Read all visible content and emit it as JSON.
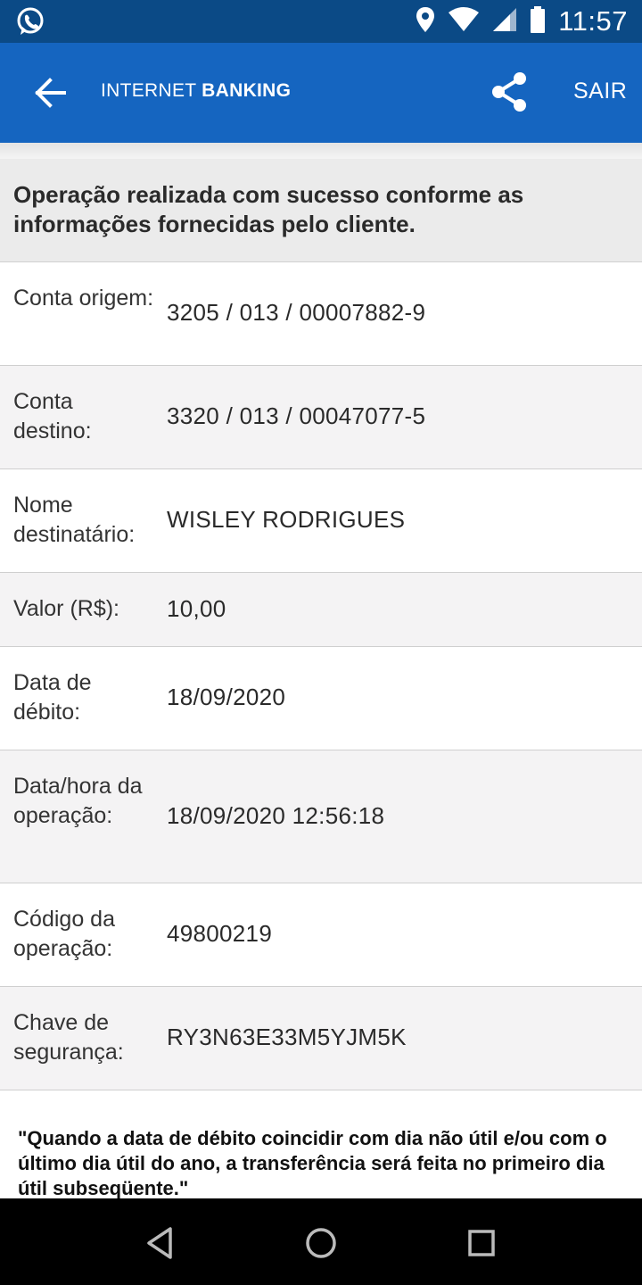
{
  "status_bar": {
    "time": "11:57",
    "icons": [
      "whatsapp-icon",
      "location-icon",
      "wifi-icon",
      "signal-icon",
      "battery-icon"
    ]
  },
  "app_bar": {
    "title_regular": "INTERNET",
    "title_bold": "BANKING",
    "exit_label": "SAIR",
    "background_color": "#1565c0"
  },
  "success_message": "Operação realizada com sucesso conforme as informações fornecidas pelo cliente.",
  "details": [
    {
      "label": "Conta origem:",
      "value": "3205 / 013 / 00007882-9"
    },
    {
      "label": "Conta destino:",
      "value": "3320 / 013 / 00047077-5"
    },
    {
      "label": "Nome destinatário:",
      "value": "WISLEY RODRIGUES"
    },
    {
      "label": "Valor (R$):",
      "value": "10,00"
    },
    {
      "label": "Data de débito:",
      "value": "18/09/2020"
    },
    {
      "label": "Data/hora da operação:",
      "value": "18/09/2020 12:56:18"
    },
    {
      "label": "Código da operação:",
      "value": "49800219"
    },
    {
      "label": "Chave de segurança:",
      "value": "RY3N63E33M5YJM5K"
    }
  ],
  "footer_note": "\"Quando a data de débito coincidir com dia não útil e/ou com o último dia útil do ano, a transferência será feita no primeiro dia útil subseqüente.\"",
  "nav_bar": {
    "icons": [
      "back-triangle-icon",
      "home-circle-icon",
      "recents-square-icon"
    ]
  }
}
